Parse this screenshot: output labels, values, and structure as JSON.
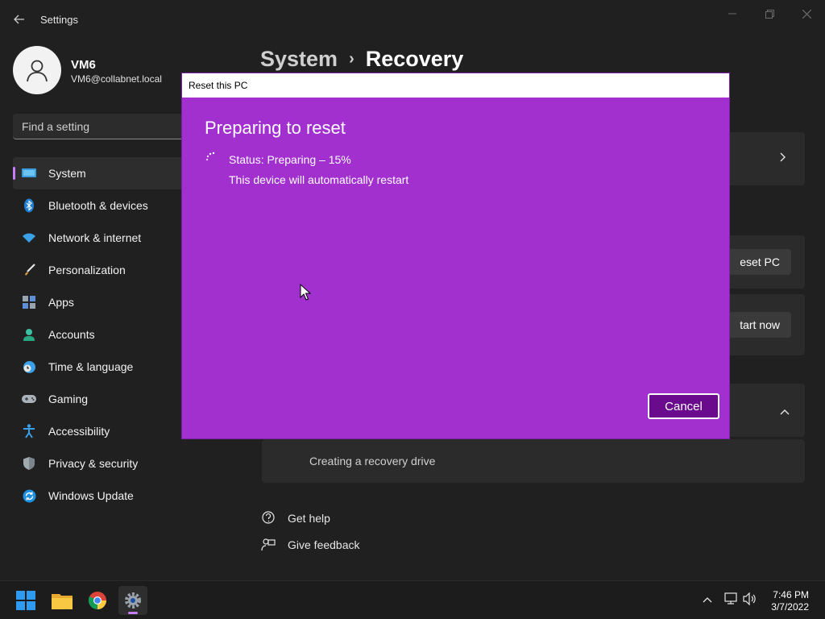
{
  "window": {
    "title": "Settings"
  },
  "profile": {
    "name": "VM6",
    "email": "VM6@collabnet.local"
  },
  "search": {
    "placeholder": "Find a setting"
  },
  "sidebar": {
    "items": [
      {
        "label": "System",
        "icon": "monitor-icon",
        "active": true
      },
      {
        "label": "Bluetooth & devices",
        "icon": "bluetooth-icon"
      },
      {
        "label": "Network & internet",
        "icon": "wifi-icon"
      },
      {
        "label": "Personalization",
        "icon": "brush-icon"
      },
      {
        "label": "Apps",
        "icon": "apps-icon"
      },
      {
        "label": "Accounts",
        "icon": "person-icon"
      },
      {
        "label": "Time & language",
        "icon": "clock-globe-icon"
      },
      {
        "label": "Gaming",
        "icon": "gamepad-icon"
      },
      {
        "label": "Accessibility",
        "icon": "accessibility-icon"
      },
      {
        "label": "Privacy & security",
        "icon": "shield-icon"
      },
      {
        "label": "Windows Update",
        "icon": "update-icon"
      }
    ]
  },
  "header": {
    "parent": "System",
    "separator": "›",
    "current": "Recovery"
  },
  "main": {
    "reset_button_partial": "eset PC",
    "start_now_partial": "tart now",
    "recovery_drive_label": "Creating a recovery drive",
    "get_help": "Get help",
    "give_feedback": "Give feedback"
  },
  "dialog": {
    "title": "Reset this PC",
    "heading": "Preparing to reset",
    "status": "Status: Preparing – 15%",
    "restart_note": "This device will automatically restart",
    "cancel_label": "Cancel",
    "bg_color": "#a130cf"
  },
  "taskbar": {
    "time": "7:46 PM",
    "date": "3/7/2022",
    "icons": [
      "windows-start-icon",
      "file-explorer-icon",
      "chrome-icon",
      "settings-icon"
    ]
  },
  "colors": {
    "accent": "#c77dff",
    "background": "#202020"
  }
}
